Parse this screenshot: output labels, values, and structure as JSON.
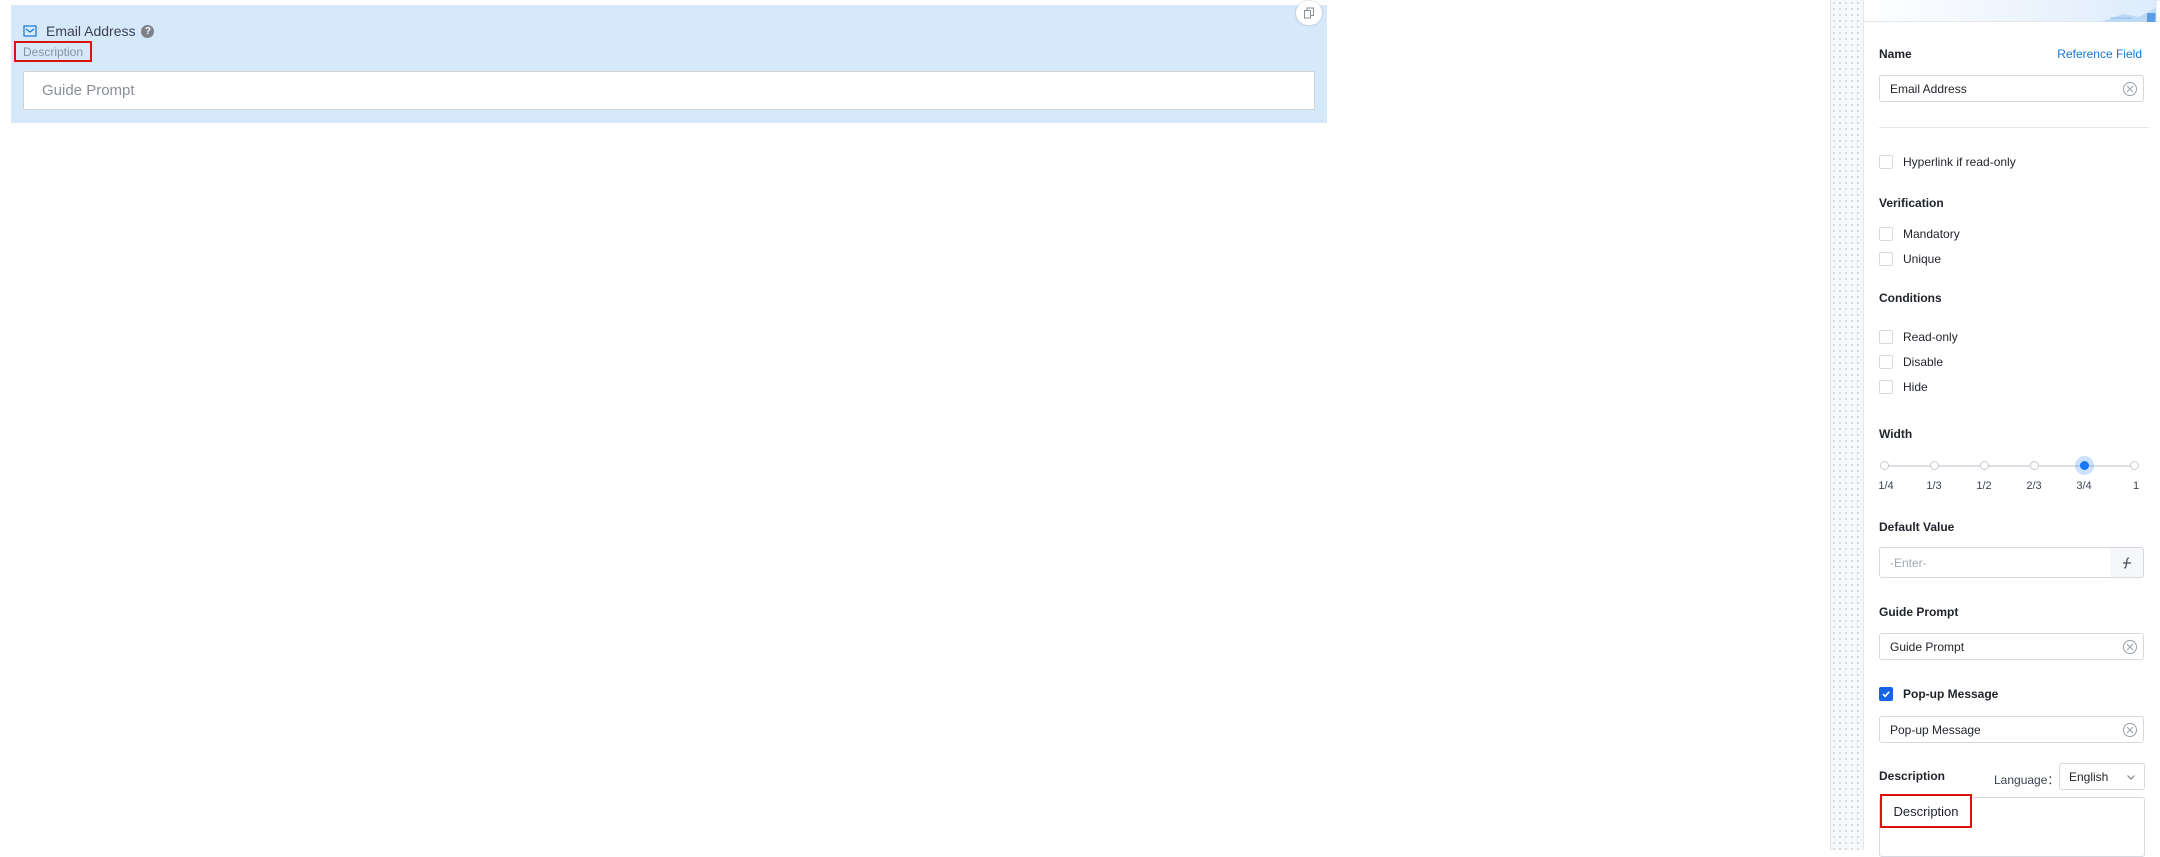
{
  "canvas": {
    "field": {
      "label": "Email Address",
      "description": "Description",
      "placeholder": "Guide Prompt",
      "icons": [
        "mail-icon",
        "help-icon",
        "copy-icon"
      ]
    }
  },
  "panel": {
    "name_label": "Name",
    "reference_link": "Reference Field",
    "name_value": "Email Address",
    "hyperlink_label": "Hyperlink if read-only",
    "verification": {
      "title": "Verification",
      "items": [
        "Mandatory",
        "Unique"
      ]
    },
    "conditions": {
      "title": "Conditions",
      "items": [
        "Read-only",
        "Disable",
        "Hide"
      ]
    },
    "width": {
      "title": "Width",
      "ticks": [
        "1/4",
        "1/3",
        "1/2",
        "2/3",
        "3/4",
        "1"
      ],
      "selected": "3/4"
    },
    "default_value": {
      "title": "Default Value",
      "placeholder": "-Enter-"
    },
    "guide_prompt": {
      "title": "Guide Prompt",
      "value": "Guide Prompt"
    },
    "popup": {
      "label": "Pop-up Message",
      "checked": true,
      "value": "Pop-up Message"
    },
    "description": {
      "title": "Description",
      "language_label": "Language：",
      "language_value": "English",
      "value": "Description"
    }
  },
  "colors": {
    "card_bg": "#d5e9fb",
    "accent": "#1677ff",
    "highlight_border": "#d9140f"
  }
}
